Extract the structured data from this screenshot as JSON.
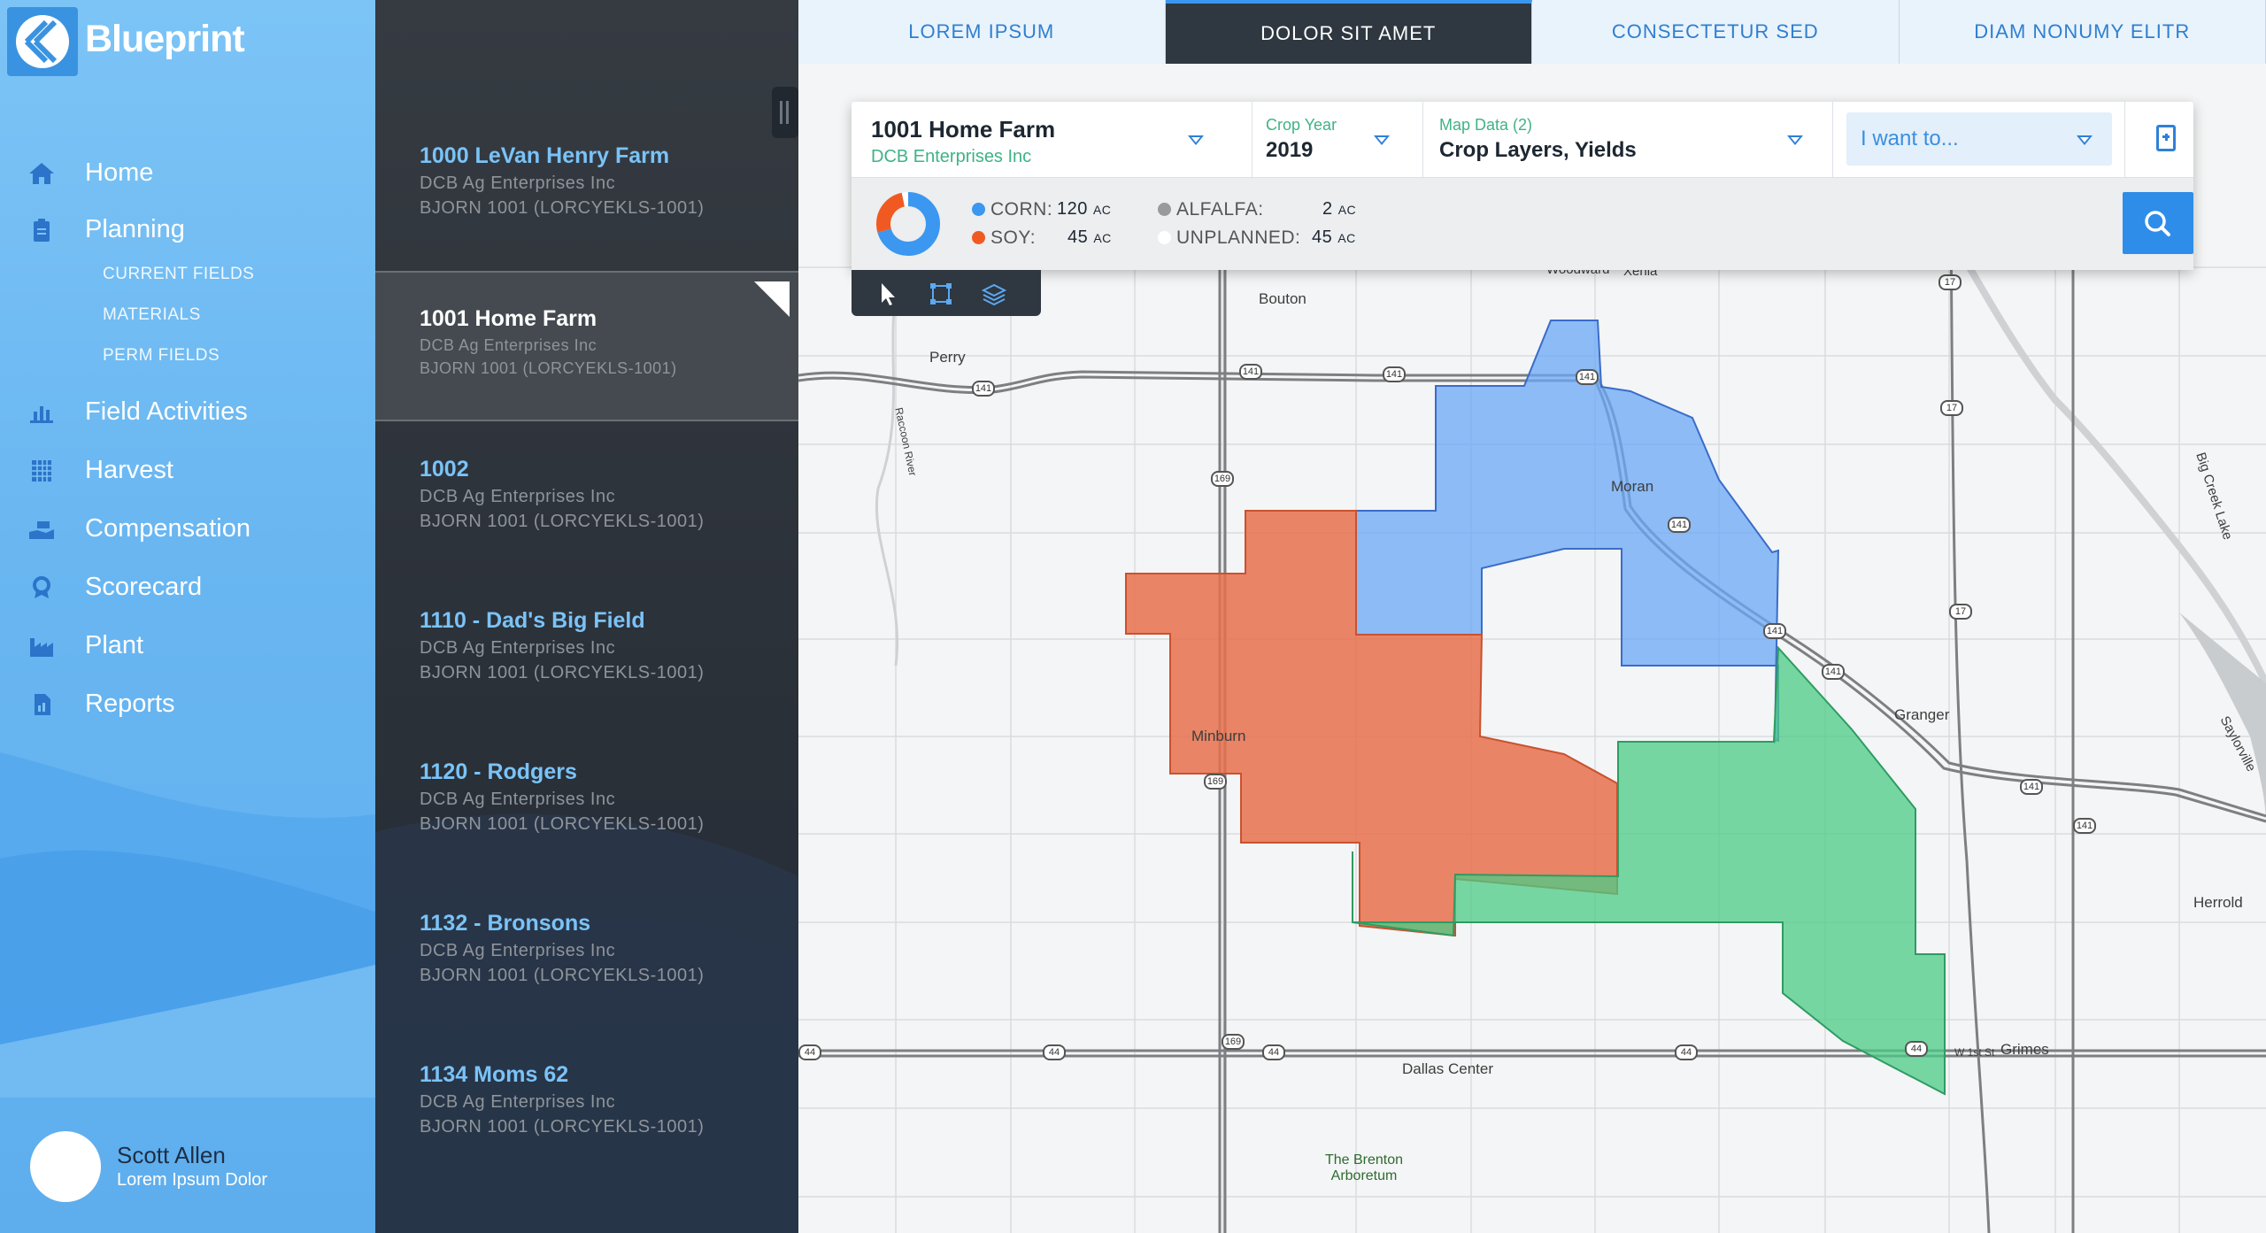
{
  "app": {
    "name": "Blueprint"
  },
  "nav": {
    "items": [
      {
        "label": "Home",
        "icon": "home-icon"
      },
      {
        "label": "Planning",
        "icon": "clipboard-icon"
      },
      {
        "label": "Field Activities",
        "icon": "bar-chart-icon"
      },
      {
        "label": "Harvest",
        "icon": "grid-pattern-icon"
      },
      {
        "label": "Compensation",
        "icon": "hand-cash-icon"
      },
      {
        "label": "Scorecard",
        "icon": "award-icon"
      },
      {
        "label": "Plant",
        "icon": "factory-icon"
      },
      {
        "label": "Reports",
        "icon": "report-document-icon"
      }
    ],
    "planning_sub": [
      "CURRENT FIELDS",
      "MATERIALS",
      "PERM FIELDS"
    ]
  },
  "user": {
    "name": "Scott Allen",
    "subtitle": "Lorem Ipsum Dolor"
  },
  "farms": [
    {
      "name": "1000 LeVan Henry Farm",
      "line2": "DCB Ag Enterprises Inc",
      "line3": "BJORN 1001 (LORCYEKLS-1001)"
    },
    {
      "name": "1001 Home Farm",
      "line2": "DCB Ag Enterprises Inc",
      "line3": "BJORN 1001 (LORCYEKLS-1001)",
      "selected": true
    },
    {
      "name": "1002",
      "line2": "DCB Ag Enterprises Inc",
      "line3": "BJORN 1001 (LORCYEKLS-1001)"
    },
    {
      "name": "1110 - Dad's Big Field",
      "line2": "DCB Ag Enterprises Inc",
      "line3": "BJORN 1001 (LORCYEKLS-1001)"
    },
    {
      "name": "1120 - Rodgers",
      "line2": "DCB Ag Enterprises Inc",
      "line3": "BJORN 1001 (LORCYEKLS-1001)"
    },
    {
      "name": "1132 - Bronsons",
      "line2": "DCB Ag Enterprises Inc",
      "line3": "BJORN 1001 (LORCYEKLS-1001)"
    },
    {
      "name": "1134 Moms 62",
      "line2": "DCB Ag Enterprises Inc",
      "line3": "BJORN 1001 (LORCYEKLS-1001)"
    }
  ],
  "tabs": [
    "LOREM IPSUM",
    "DOLOR SIT AMET",
    "CONSECTETUR SED",
    "DIAM NONUMY ELITR"
  ],
  "active_tab": "DOLOR SIT AMET",
  "panel": {
    "farm_name": "1001 Home Farm",
    "company": "DCB Enterprises Inc",
    "crop_year_label": "Crop Year",
    "crop_year": "2019",
    "map_data_label": "Map Data (2)",
    "map_data_value": "Crop Layers, Yields",
    "want_placeholder": "I want to...",
    "stats": [
      {
        "label": "CORN:",
        "value": "120",
        "unit": "AC",
        "color": "#3b97ef"
      },
      {
        "label": "SOY:",
        "value": "45",
        "unit": "AC",
        "color": "#f05a22"
      },
      {
        "label": "ALFALFA:",
        "value": "2",
        "unit": "AC",
        "color": "#9a9a9a"
      },
      {
        "label": "UNPLANNED:",
        "value": "45",
        "unit": "AC",
        "color": "#ffffff"
      }
    ]
  },
  "map": {
    "places": [
      "Bouton",
      "Woodward",
      "Xenia",
      "Perry",
      "Moran",
      "Minburn",
      "Granger",
      "Herrold",
      "Dallas Center",
      "Grimes",
      "The Brenton Arboretum",
      "Big Creek Lake",
      "Saylorville",
      "Raccoon River",
      "W 1st St"
    ],
    "shields": [
      "141",
      "141",
      "141",
      "141",
      "141",
      "141",
      "141",
      "141",
      "141",
      "169",
      "169",
      "169",
      "17",
      "17",
      "17",
      "44",
      "44",
      "44",
      "44",
      "44"
    ]
  },
  "colors": {
    "corn": "#6aa7f5",
    "soy": "#e9825e",
    "unplanned": "#5fcf8e",
    "accent": "#2e8de9"
  }
}
